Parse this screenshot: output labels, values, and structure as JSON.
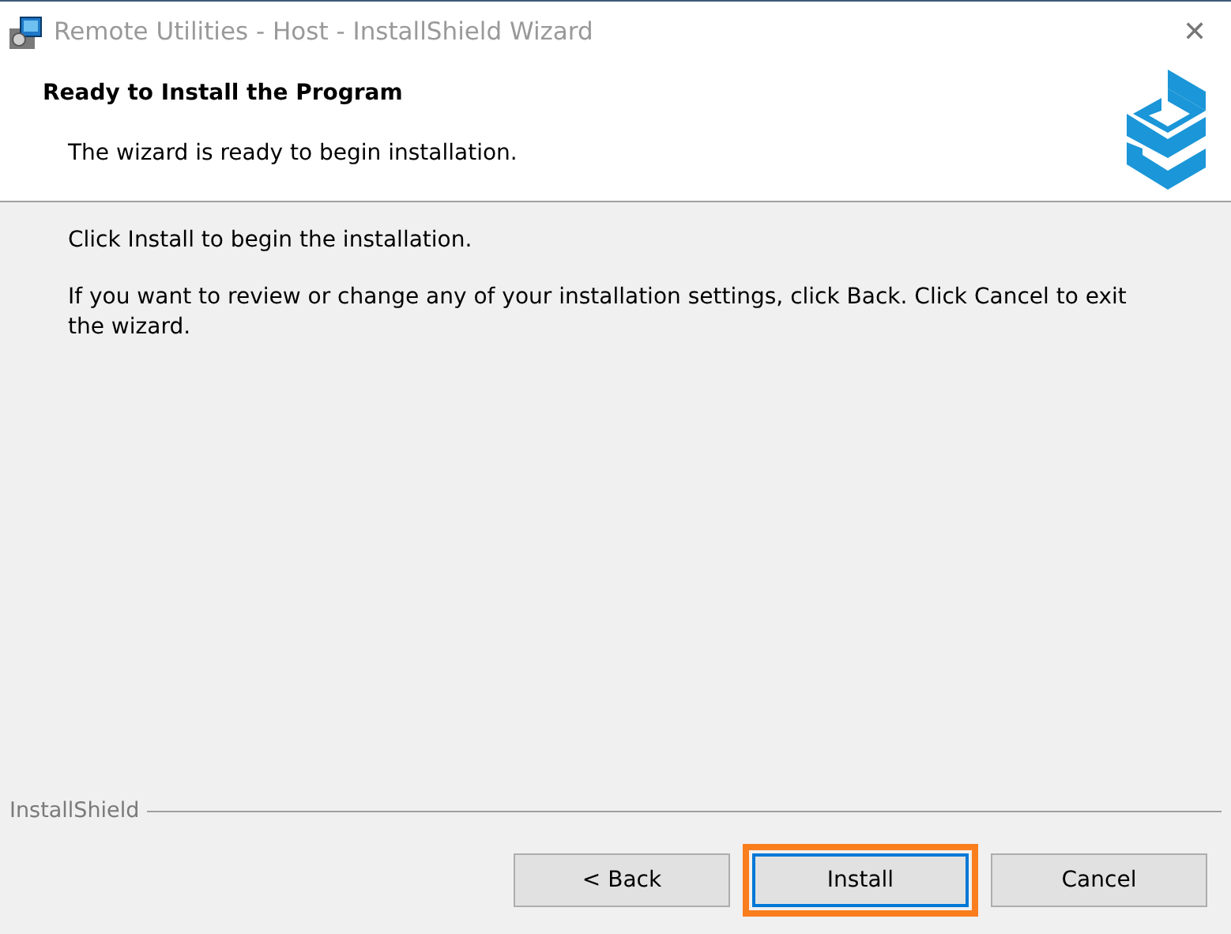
{
  "window": {
    "title": "Remote Utilities - Host - InstallShield Wizard",
    "close": "✕"
  },
  "header": {
    "title": "Ready to Install the Program",
    "subtitle": "The wizard is ready to begin installation."
  },
  "body": {
    "paragraphs": [
      "Click Install to begin the installation.",
      "If you want to review or change any of your installation settings, click Back. Click Cancel to exit the wizard."
    ]
  },
  "footer": {
    "brand": "InstallShield"
  },
  "buttons": [
    {
      "label": "< Back",
      "default": false,
      "highlighted": false
    },
    {
      "label": "Install",
      "default": true,
      "highlighted": true
    },
    {
      "label": "Cancel",
      "default": false,
      "highlighted": false
    }
  ]
}
